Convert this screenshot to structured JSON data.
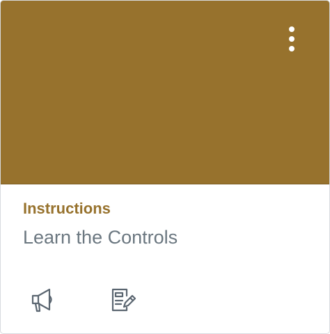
{
  "card": {
    "color": "#97722d",
    "title": "Instructions",
    "subtitle": "Learn the Controls",
    "menu_icon": "kebab-vertical-icon",
    "actions": [
      {
        "icon": "megaphone-icon",
        "target": "announcements"
      },
      {
        "icon": "assignment-edit-icon",
        "target": "assignments"
      }
    ]
  }
}
